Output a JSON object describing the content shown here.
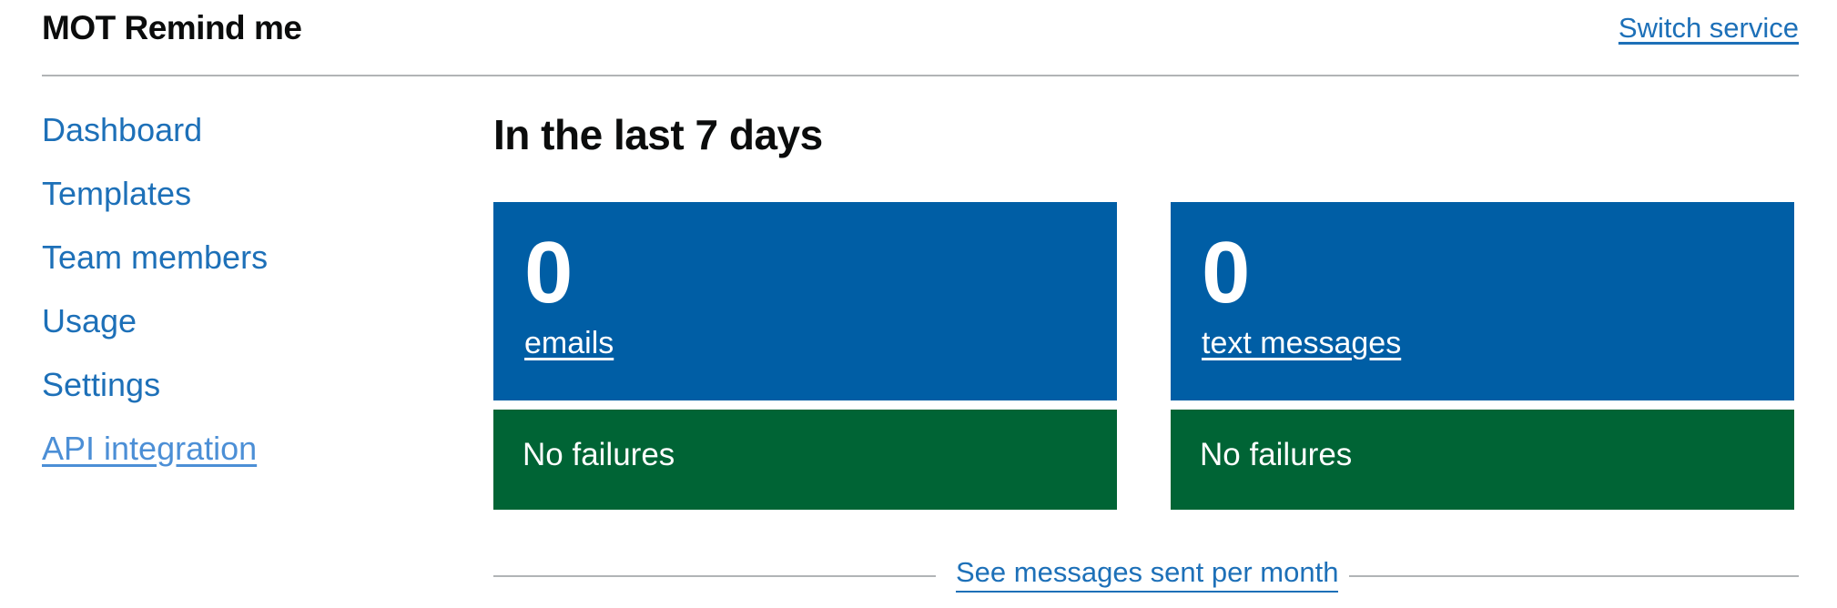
{
  "header": {
    "service_name": "MOT Remind me",
    "switch_service": "Switch service"
  },
  "sidebar": {
    "items": [
      {
        "label": "Dashboard"
      },
      {
        "label": "Templates"
      },
      {
        "label": "Team members"
      },
      {
        "label": "Usage"
      },
      {
        "label": "Settings"
      },
      {
        "label": "API integration"
      }
    ]
  },
  "main": {
    "title": "In the last 7 days",
    "cards": [
      {
        "count": "0",
        "label": "emails",
        "status": "No failures"
      },
      {
        "count": "0",
        "label": "text messages",
        "status": "No failures"
      }
    ],
    "see_more": "See messages sent per month"
  },
  "colors": {
    "link": "#1d70b8",
    "visited_link": "#4c8fd6",
    "card_blue": "#005ea5",
    "card_green": "#006435",
    "border": "#b1b4b6"
  }
}
